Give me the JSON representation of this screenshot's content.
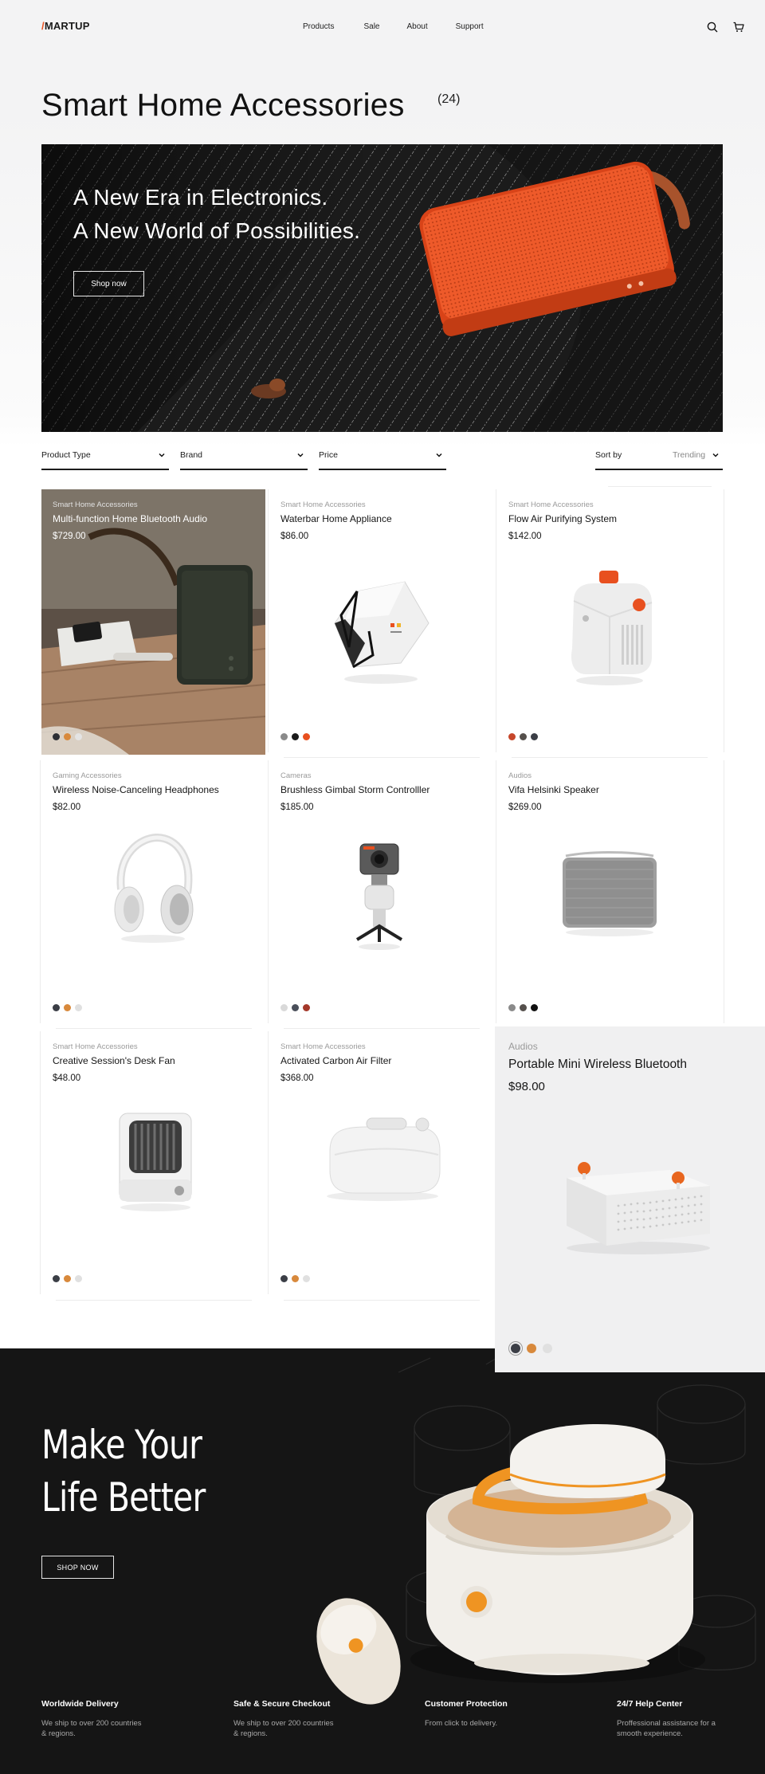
{
  "nav": {
    "logo": "MARTUP",
    "logo_mark": "/",
    "links": [
      "Products",
      "Sale",
      "About",
      "Support"
    ],
    "icons": [
      "search-icon",
      "cart-icon"
    ]
  },
  "page": {
    "title": "Smart Home Accessories",
    "count": "(24)"
  },
  "hero": {
    "headline_line1": "A New Era in Electronics.",
    "headline_line2": "A New World of Possibilities.",
    "cta": "Shop now"
  },
  "filters": {
    "product_type": "Product Type",
    "brand": "Brand",
    "price": "Price",
    "sort_label": "Sort by",
    "sort_value": "Trending"
  },
  "products": [
    {
      "category": "Smart Home Accessories",
      "name": "Multi-function Home Bluetooth Audio",
      "price": "$729.00",
      "swatches": [
        "#2d2f35",
        "#d8893c",
        "#e4e4e4"
      ]
    },
    {
      "category": "Smart Home Accessories",
      "name": "Waterbar Home Appliance",
      "price": "$86.00",
      "swatches": [
        "#8a8a8a",
        "#1b1b1b",
        "#e8501f"
      ]
    },
    {
      "category": "Smart Home Accessories",
      "name": "Flow Air Purifying System",
      "price": "$142.00",
      "swatches": [
        "#c6462a",
        "#55504c",
        "#3b3e46"
      ]
    },
    {
      "category": "Gaming Accessories",
      "name": "Wireless Noise-Canceling Headphones",
      "price": "$82.00",
      "swatches": [
        "#3b3e46",
        "#d8893c",
        "#e0e0e0"
      ]
    },
    {
      "category": "Cameras",
      "name": "Brushless Gimbal Storm Controlller",
      "price": "$185.00",
      "swatches": [
        "#d9d9d9",
        "#4a4f5a",
        "#a4382a"
      ]
    },
    {
      "category": "Audios",
      "name": "Vifa Helsinki Speaker",
      "price": "$269.00",
      "swatches": [
        "#8a8a8a",
        "#55504c",
        "#111111"
      ]
    },
    {
      "category": "Smart Home Accessories",
      "name": "Creative Session's Desk Fan",
      "price": "$48.00",
      "swatches": [
        "#3b3e46",
        "#d8893c",
        "#e0e0e0"
      ]
    },
    {
      "category": "Smart Home Accessories",
      "name": "Activated Carbon Air Filter",
      "price": "$368.00",
      "swatches": [
        "#3b3e46",
        "#d8893c",
        "#e0e0e0"
      ]
    },
    {
      "category": "Audios",
      "name": "Portable Mini Wireless Bluetooth",
      "price": "$98.00",
      "swatches": [
        "#3b3e46",
        "#d8893c",
        "#e0e0e0"
      ]
    }
  ],
  "promo": {
    "headline_line1": "Make Your",
    "headline_line2": "Life Better",
    "cta": "SHOP NOW"
  },
  "features": [
    {
      "title": "Worldwide Delivery",
      "desc_line1": "We ship to over 200 countries",
      "desc_line2": "& regions."
    },
    {
      "title": "Safe & Secure Checkout",
      "desc_line1": "We ship to over 200 countries",
      "desc_line2": "& regions."
    },
    {
      "title": "Customer Protection",
      "desc_line1": "From click to delivery.",
      "desc_line2": ""
    },
    {
      "title": "24/7 Help Center",
      "desc_line1": "Proffessional assistance for a",
      "desc_line2": "smooth experience."
    }
  ],
  "colors": {
    "accent": "#e8501f",
    "dark_bg": "#151515"
  }
}
